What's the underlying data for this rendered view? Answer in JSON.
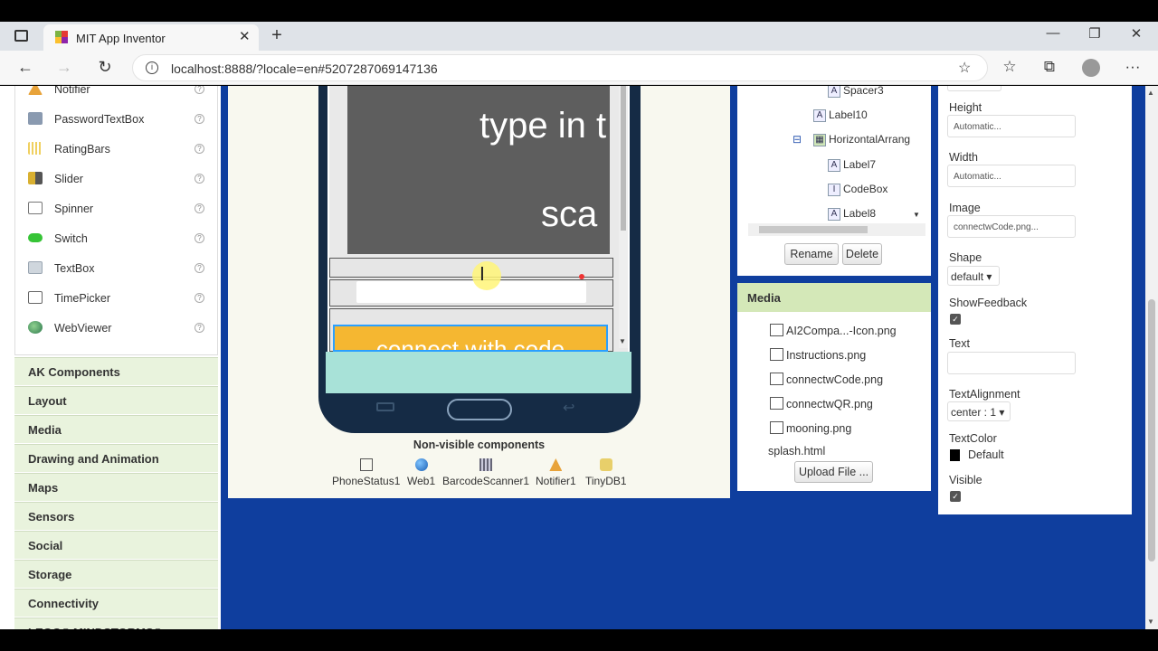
{
  "browser": {
    "tab_title": "MIT App Inventor",
    "tab_close": "✕",
    "new_tab": "+",
    "url": "localhost:8888/?locale=en#5207287069147136",
    "win_minimize": "—",
    "win_restore": "❐",
    "win_close": "✕",
    "back": "←",
    "forward": "→",
    "reload": "↻",
    "info": "i",
    "favorite": "☆",
    "favorites": "☆",
    "collections": "⧉",
    "more": "···"
  },
  "palette": {
    "items": [
      {
        "label": "Notifier",
        "icon": "warning-icon",
        "color": "#e8a33a"
      },
      {
        "label": "PasswordTextBox",
        "icon": "password-icon",
        "color": "#8a9ab0"
      },
      {
        "label": "RatingBars",
        "icon": "rating-icon",
        "color": "#f0d060"
      },
      {
        "label": "Slider",
        "icon": "slider-icon",
        "color": "#d9b030"
      },
      {
        "label": "Spinner",
        "icon": "spinner-icon",
        "color": "#888888"
      },
      {
        "label": "Switch",
        "icon": "switch-icon",
        "color": "#36c436"
      },
      {
        "label": "TextBox",
        "icon": "textbox-icon",
        "color": "#9aa6b2"
      },
      {
        "label": "TimePicker",
        "icon": "timepicker-icon",
        "color": "#666666"
      },
      {
        "label": "WebViewer",
        "icon": "globe-icon",
        "color": "#2f7a4f"
      }
    ],
    "help": "?",
    "categories": [
      "AK Components",
      "Layout",
      "Media",
      "Drawing and Animation",
      "Maps",
      "Sensors",
      "Social",
      "Storage",
      "Connectivity",
      "LEGO® MINDSTORMS®"
    ]
  },
  "viewer": {
    "hero_text_1": "type in t",
    "hero_text_2": "sca",
    "connect_button": "connect with code",
    "cursor": "I",
    "nonvisible_title": "Non-visible components",
    "nonvisible": [
      "PhoneStatus1",
      "Web1",
      "BarcodeScanner1",
      "Notifier1",
      "TinyDB1"
    ]
  },
  "tree": {
    "nodes": [
      {
        "label": "Spacer3",
        "icon": "A"
      },
      {
        "label": "Label10",
        "icon": "A"
      },
      {
        "label": "HorizontalArrang",
        "icon": "▦"
      },
      {
        "label": "Label7",
        "icon": "A"
      },
      {
        "label": "CodeBox",
        "icon": "I"
      },
      {
        "label": "Label8",
        "icon": "A"
      }
    ],
    "collapse": "⊟",
    "rename": "Rename",
    "delete": "Delete"
  },
  "media": {
    "title": "Media",
    "files": [
      "AI2Compa...-Icon.png",
      "Instructions.png",
      "connectwCode.png",
      "connectwQR.png",
      "mooning.png"
    ],
    "plain_file": "splash.html",
    "upload": "Upload File ..."
  },
  "props": {
    "height_label": "Height",
    "height_value": "Automatic...",
    "width_label": "Width",
    "width_value": "Automatic...",
    "image_label": "Image",
    "image_value": "connectwCode.png...",
    "shape_label": "Shape",
    "shape_value": "default ▾",
    "showfeedback_label": "ShowFeedback",
    "text_label": "Text",
    "text_value": "",
    "textalign_label": "TextAlignment",
    "textalign_value": "center : 1 ▾",
    "textcolor_label": "TextColor",
    "textcolor_value": "Default",
    "visible_label": "Visible",
    "check": "✓"
  }
}
